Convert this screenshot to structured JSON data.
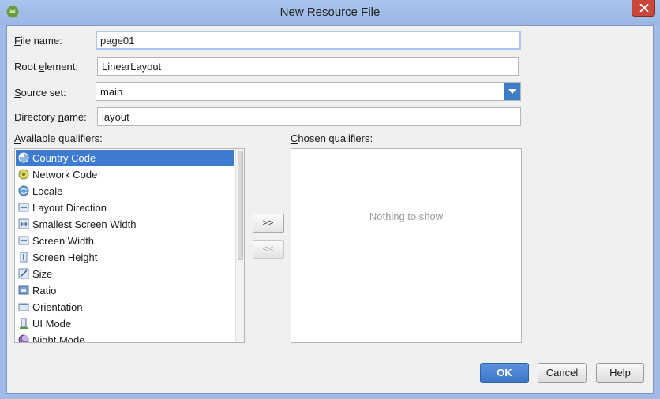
{
  "window": {
    "title": "New Resource File",
    "app_icon": "android-icon",
    "close_icon": "close-icon"
  },
  "form": {
    "file_name": {
      "label_mnemonic": "F",
      "label_rest": "ile name:",
      "value": "page01"
    },
    "root_element": {
      "label_pre": "Root ",
      "label_mnemonic": "e",
      "label_rest": "lement:",
      "value": "LinearLayout"
    },
    "source_set": {
      "label_mnemonic": "S",
      "label_rest": "ource set:",
      "value": "main"
    },
    "directory_name": {
      "label_pre": "Directory ",
      "label_mnemonic": "n",
      "label_rest": "ame:",
      "value": "layout"
    }
  },
  "available": {
    "label_mnemonic": "A",
    "label_rest": "vailable qualifiers:",
    "items": [
      {
        "label": "Country Code",
        "icon": "globe-flag-icon",
        "selected": true
      },
      {
        "label": "Network Code",
        "icon": "network-icon",
        "selected": false
      },
      {
        "label": "Locale",
        "icon": "globe-icon",
        "selected": false
      },
      {
        "label": "Layout Direction",
        "icon": "layout-direction-icon",
        "selected": false
      },
      {
        "label": "Smallest Screen Width",
        "icon": "smallest-width-icon",
        "selected": false
      },
      {
        "label": "Screen Width",
        "icon": "screen-width-icon",
        "selected": false
      },
      {
        "label": "Screen Height",
        "icon": "screen-height-icon",
        "selected": false
      },
      {
        "label": "Size",
        "icon": "size-icon",
        "selected": false
      },
      {
        "label": "Ratio",
        "icon": "ratio-icon",
        "selected": false
      },
      {
        "label": "Orientation",
        "icon": "orientation-icon",
        "selected": false
      },
      {
        "label": "UI Mode",
        "icon": "ui-mode-icon",
        "selected": false
      },
      {
        "label": "Night Mode",
        "icon": "night-mode-icon",
        "selected": false
      }
    ]
  },
  "chosen": {
    "label_mnemonic": "C",
    "label_rest": "hosen qualifiers:",
    "empty_text": "Nothing to show"
  },
  "move": {
    "add_label": ">>",
    "remove_label": "<<"
  },
  "buttons": {
    "ok": "OK",
    "cancel": "Cancel",
    "help": "Help"
  },
  "colors": {
    "accent": "#3d7bd0",
    "title_bar": "#9fbbe6",
    "close": "#c9473c"
  }
}
